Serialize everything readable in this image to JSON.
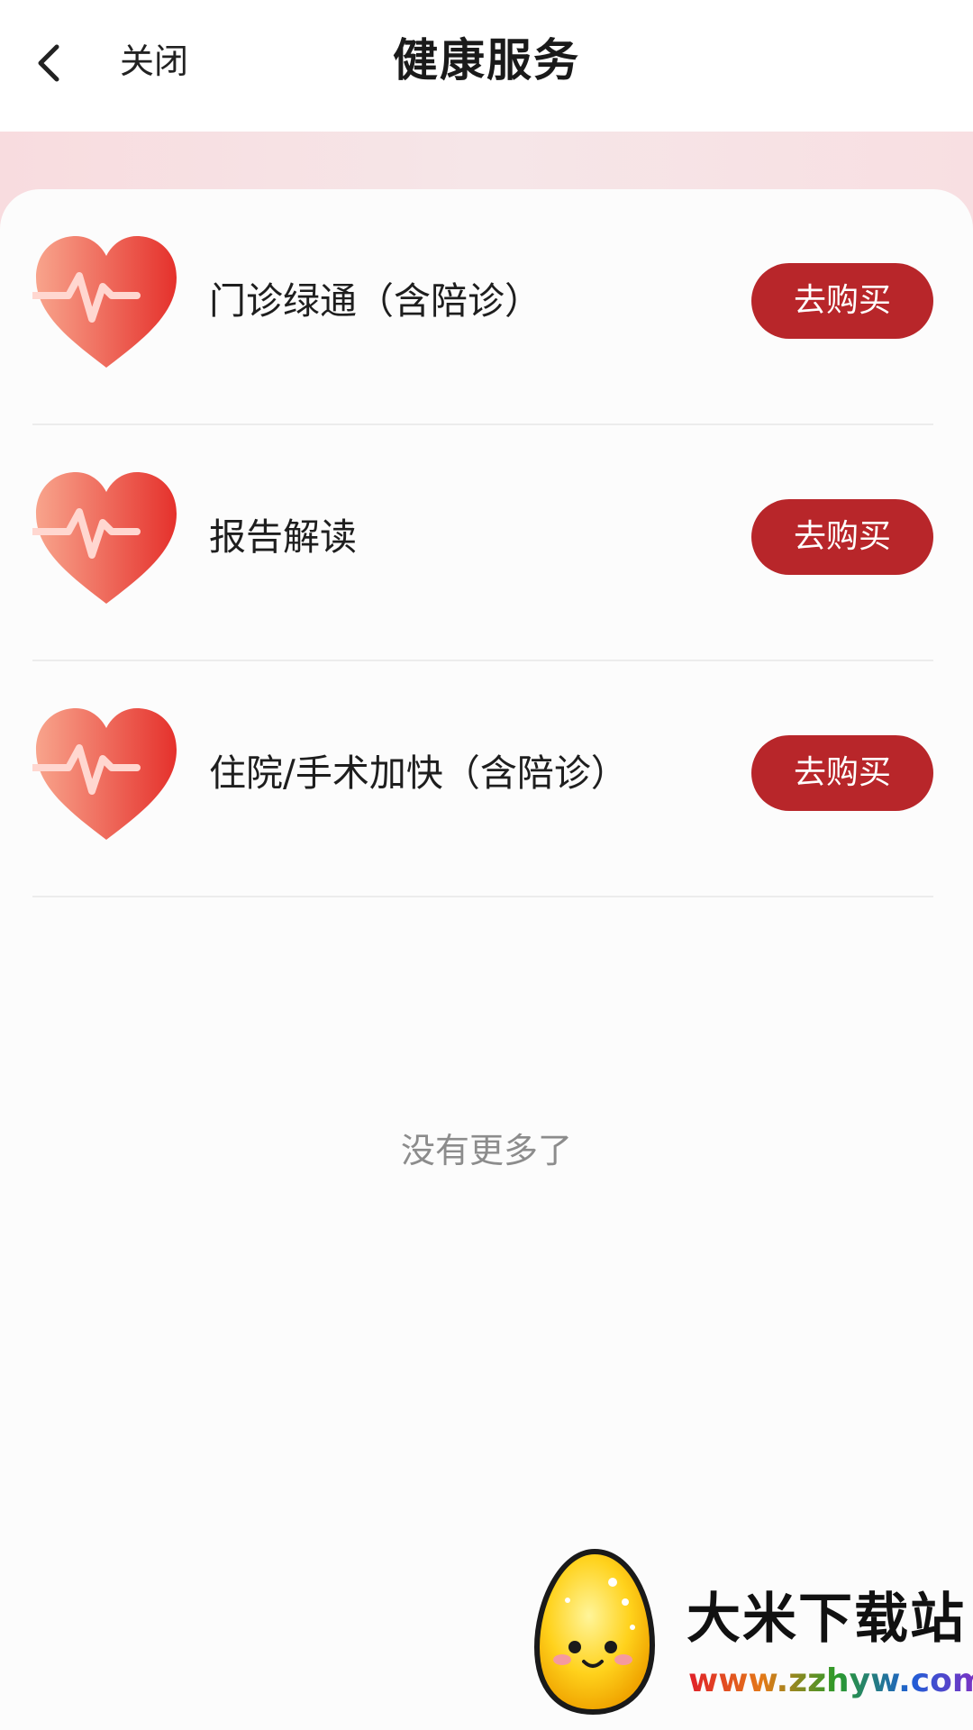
{
  "header": {
    "close_label": "关闭",
    "title": "健康服务"
  },
  "services": [
    {
      "name": "门诊绿通（含陪诊）",
      "button_label": "去购买"
    },
    {
      "name": "报告解读",
      "button_label": "去购买"
    },
    {
      "name": "住院/手术加快（含陪诊）",
      "button_label": "去购买"
    }
  ],
  "footer": {
    "no_more": "没有更多了"
  },
  "watermark": {
    "title": "大米下载站",
    "url": "www.zzhyw.com"
  },
  "colors": {
    "accent": "#b8262a",
    "heart_light": "#f5907a",
    "heart_dark": "#e53a34"
  },
  "icons": {
    "back": "chevron-left-icon",
    "service": "heart-pulse-icon"
  }
}
